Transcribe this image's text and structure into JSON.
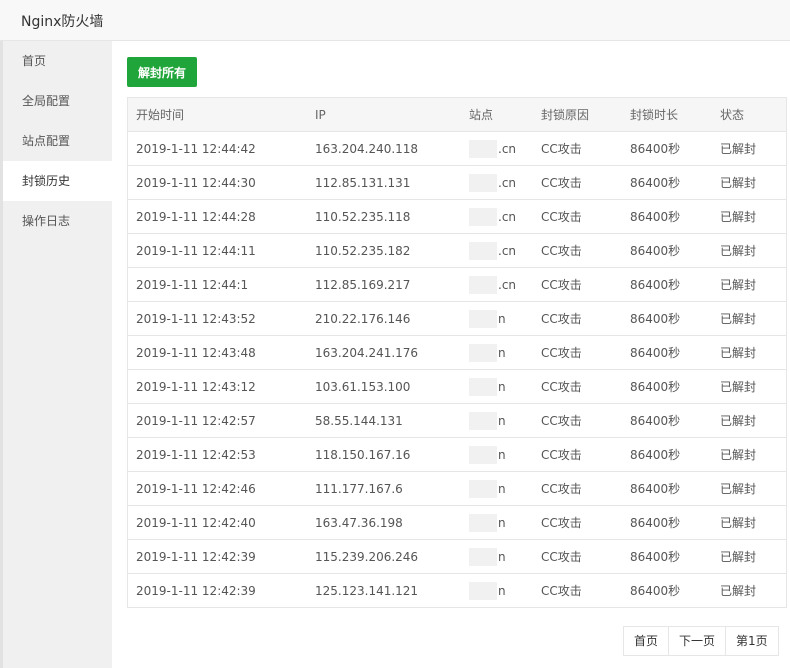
{
  "window": {
    "title": "Nginx防火墙"
  },
  "sidebar": {
    "items": [
      {
        "label": "首页"
      },
      {
        "label": "全局配置"
      },
      {
        "label": "站点配置"
      },
      {
        "label": "封锁历史"
      },
      {
        "label": "操作日志"
      }
    ],
    "active_index": 3
  },
  "toolbar": {
    "unblock_all_label": "解封所有"
  },
  "colors": {
    "accent": "#20a53a"
  },
  "table": {
    "headers": {
      "start_time": "开始时间",
      "ip": "IP",
      "site": "站点",
      "reason": "封锁原因",
      "duration": "封锁时长",
      "status": "状态"
    },
    "rows": [
      {
        "time": "2019-1-11 12:44:42",
        "ip": "163.204.240.118",
        "site": ".cn",
        "reason": "CC攻击",
        "duration": "86400秒",
        "status": "已解封"
      },
      {
        "time": "2019-1-11 12:44:30",
        "ip": "112.85.131.131",
        "site": ".cn",
        "reason": "CC攻击",
        "duration": "86400秒",
        "status": "已解封"
      },
      {
        "time": "2019-1-11 12:44:28",
        "ip": "110.52.235.118",
        "site": ".cn",
        "reason": "CC攻击",
        "duration": "86400秒",
        "status": "已解封"
      },
      {
        "time": "2019-1-11 12:44:11",
        "ip": "110.52.235.182",
        "site": ".cn",
        "reason": "CC攻击",
        "duration": "86400秒",
        "status": "已解封"
      },
      {
        "time": "2019-1-11 12:44:1",
        "ip": "112.85.169.217",
        "site": ".cn",
        "reason": "CC攻击",
        "duration": "86400秒",
        "status": "已解封"
      },
      {
        "time": "2019-1-11 12:43:52",
        "ip": "210.22.176.146",
        "site": "n",
        "reason": "CC攻击",
        "duration": "86400秒",
        "status": "已解封"
      },
      {
        "time": "2019-1-11 12:43:48",
        "ip": "163.204.241.176",
        "site": "n",
        "reason": "CC攻击",
        "duration": "86400秒",
        "status": "已解封"
      },
      {
        "time": "2019-1-11 12:43:12",
        "ip": "103.61.153.100",
        "site": "n",
        "reason": "CC攻击",
        "duration": "86400秒",
        "status": "已解封"
      },
      {
        "time": "2019-1-11 12:42:57",
        "ip": "58.55.144.131",
        "site": "n",
        "reason": "CC攻击",
        "duration": "86400秒",
        "status": "已解封"
      },
      {
        "time": "2019-1-11 12:42:53",
        "ip": "118.150.167.16",
        "site": "n",
        "reason": "CC攻击",
        "duration": "86400秒",
        "status": "已解封"
      },
      {
        "time": "2019-1-11 12:42:46",
        "ip": "111.177.167.6",
        "site": "n",
        "reason": "CC攻击",
        "duration": "86400秒",
        "status": "已解封"
      },
      {
        "time": "2019-1-11 12:42:40",
        "ip": "163.47.36.198",
        "site": "n",
        "reason": "CC攻击",
        "duration": "86400秒",
        "status": "已解封"
      },
      {
        "time": "2019-1-11 12:42:39",
        "ip": "115.239.206.246",
        "site": "n",
        "reason": "CC攻击",
        "duration": "86400秒",
        "status": "已解封"
      },
      {
        "time": "2019-1-11 12:42:39",
        "ip": "125.123.141.121",
        "site": "n",
        "reason": "CC攻击",
        "duration": "86400秒",
        "status": "已解封"
      }
    ]
  },
  "pager": {
    "first_label": "首页",
    "next_label": "下一页",
    "current_label": "第1页"
  }
}
